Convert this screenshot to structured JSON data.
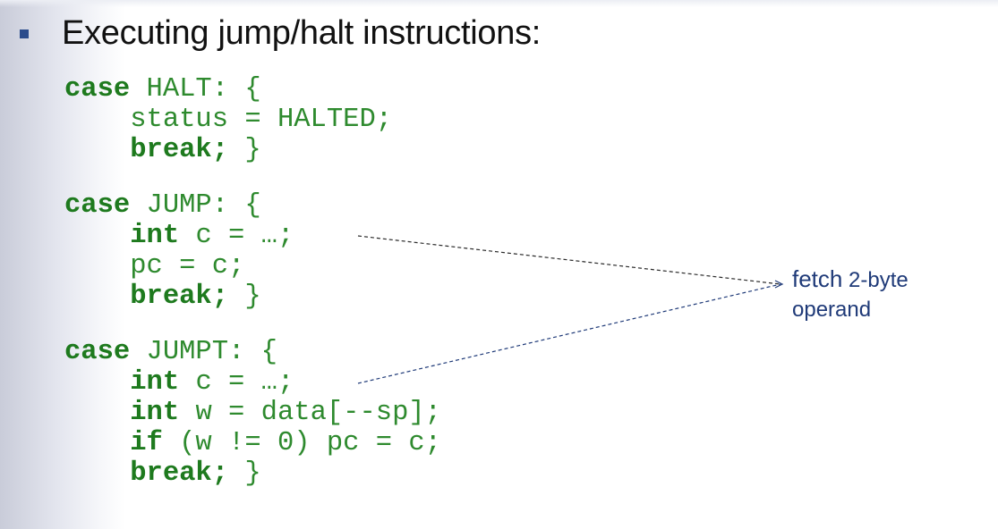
{
  "heading": "Executing jump/halt instructions:",
  "code": {
    "halt": {
      "kw_case": "case",
      "label": " HALT: {",
      "line2": "    status = HALTED;",
      "kw_break": "break;",
      "close": " }"
    },
    "jump": {
      "kw_case": "case",
      "label": " JUMP: {",
      "kw_int": "int",
      "line2_rest": " c = …;",
      "line3": "    pc = c;",
      "kw_break": "break;",
      "close": " }"
    },
    "jumpt": {
      "kw_case": "case",
      "label": " JUMPT: {",
      "kw_int1": "int",
      "line2_rest": " c = …;",
      "kw_int2": "int",
      "line3_rest": " w = data[--sp];",
      "kw_if": "if",
      "line4_rest": " (w != 0) pc = c;",
      "kw_break": "break;",
      "close": " }"
    }
  },
  "annotation": {
    "word1": "fetch",
    "word2": " 2-byte",
    "word3": "operand"
  },
  "colors": {
    "code": "#2e8a2e",
    "annotation": "#1f3a78",
    "bullet": "#2b4c8c"
  }
}
